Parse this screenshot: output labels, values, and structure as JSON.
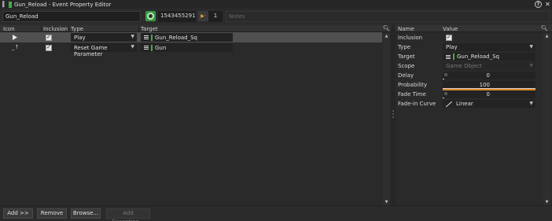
{
  "window": {
    "title": "Gun_Reload - Event Property Editor",
    "help_glyph": "?",
    "close_glyph": "✕"
  },
  "header": {
    "name_value": "Gun_Reload",
    "id_value": "1543455291",
    "color_value": "1",
    "notes_placeholder": "Notes"
  },
  "actions_table": {
    "columns": [
      "Icon",
      "Inclusion",
      "Type",
      "Target"
    ],
    "rows": [
      {
        "icon": "play-icon",
        "inclusion": true,
        "type": "Play",
        "target": "Gun_Reload_Sq",
        "selected": true
      },
      {
        "icon": "reset-parameter-icon",
        "inclusion": true,
        "type": "Reset Game Parameter",
        "target": "Gun",
        "selected": false
      }
    ]
  },
  "properties": {
    "columns": [
      "Name",
      "Value"
    ],
    "inclusion_label": "Inclusion",
    "type_label": "Type",
    "type_value": "Play",
    "target_label": "Target",
    "target_value": "Gun_Reload_Sq",
    "scope_label": "Scope",
    "scope_value": "Game Object",
    "delay_label": "Delay",
    "delay_value": "0",
    "probability_label": "Probability",
    "probability_value": "100",
    "fade_time_label": "Fade Time",
    "fade_time_value": "0",
    "fade_curve_label": "Fade-in Curve",
    "fade_curve_value": "Linear"
  },
  "buttons": {
    "add": "Add >>",
    "remove": "Remove",
    "browse": "Browse...",
    "add_exception": "Add Exception..."
  },
  "colors": {
    "accent_green": "#3fae49",
    "slider_orange": "#e08a2a"
  }
}
